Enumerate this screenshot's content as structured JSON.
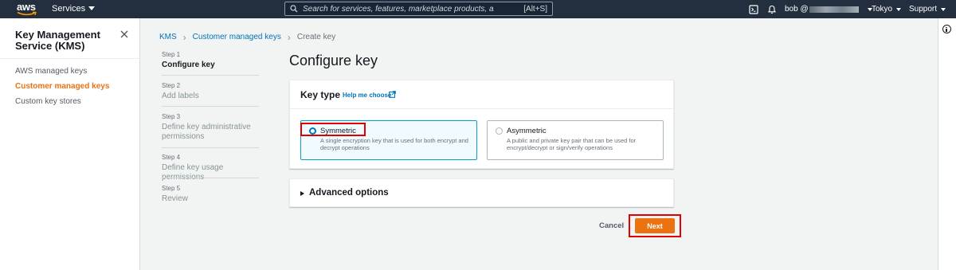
{
  "topnav": {
    "logo_text": "aws",
    "services_label": "Services",
    "search_placeholder": "Search for services, features, marketplace products, and docs",
    "search_shortcut": "[Alt+S]",
    "account": "bob @",
    "region": "Tokyo",
    "support": "Support"
  },
  "sidebar": {
    "title": "Key Management Service (KMS)",
    "items": [
      {
        "label": "AWS managed keys",
        "active": false
      },
      {
        "label": "Customer managed keys",
        "active": true
      },
      {
        "label": "Custom key stores",
        "active": false
      }
    ]
  },
  "breadcrumb": {
    "items": [
      "KMS",
      "Customer managed keys",
      "Create key"
    ]
  },
  "steps": [
    {
      "num": "Step 1",
      "name": "Configure key",
      "current": true
    },
    {
      "num": "Step 2",
      "name": "Add labels",
      "current": false
    },
    {
      "num": "Step 3",
      "name": "Define key administrative permissions",
      "current": false
    },
    {
      "num": "Step 4",
      "name": "Define key usage permissions",
      "current": false
    },
    {
      "num": "Step 5",
      "name": "Review",
      "current": false
    }
  ],
  "main": {
    "title": "Configure key",
    "key_type": {
      "heading": "Key type",
      "help_link": "Help me choose",
      "options": [
        {
          "label": "Symmetric",
          "description": "A single encryption key that is used for both encrypt and decrypt operations",
          "selected": true
        },
        {
          "label": "Asymmetric",
          "description": "A public and private key pair that can be used for encrypt/decrypt or sign/verify operations",
          "selected": false
        }
      ]
    },
    "advanced_options": "Advanced options",
    "cancel_label": "Cancel",
    "next_label": "Next"
  },
  "colors": {
    "nav_bg": "#232f3e",
    "accent_orange": "#ec7211",
    "link_blue": "#0073bb",
    "selected_border": "#00a1c9",
    "highlight_red": "#e00000"
  }
}
